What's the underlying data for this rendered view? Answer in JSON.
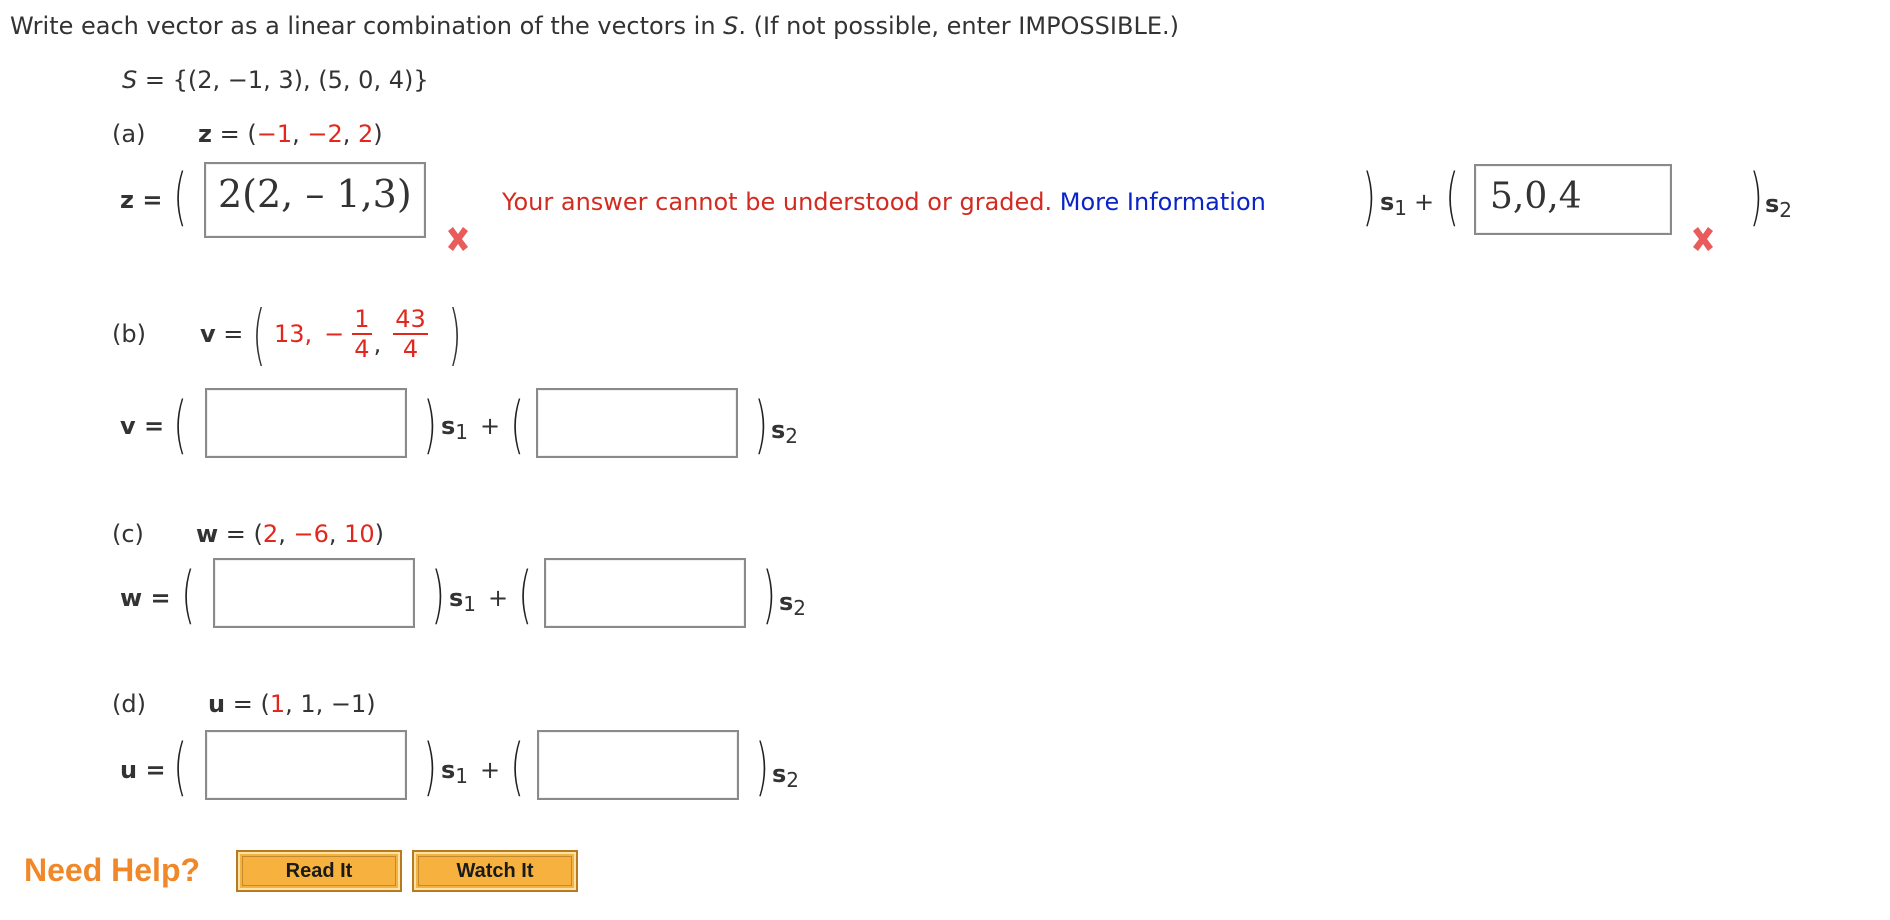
{
  "instructions": {
    "before_S": "Write each vector as a linear combination of the vectors in ",
    "S": "S",
    "after_S": ". (If not possible, enter IMPOSSIBLE.)"
  },
  "set_def": {
    "S": "S",
    "eq": " = {(2, −1, 3), (5, 0, 4)}"
  },
  "parts": {
    "a": {
      "label": "(a)",
      "vec": "z",
      "eq": " = (",
      "v1": "−1",
      "c1": ", ",
      "v2": "−2",
      "c2": ", ",
      "v3": "2",
      "close": ")",
      "row_label": "z =",
      "input1_value": "2(2, – 1,3)",
      "error_message": "Your answer cannot be understood or graded.",
      "more_info": "More Information",
      "input2_value": "5,0,4"
    },
    "b": {
      "label": "(b)",
      "vec": "v",
      "eq": " =",
      "v1": "13,",
      "minus": "−",
      "frac1_num": "1",
      "frac1_den": "4",
      "comma": ",",
      "frac2_num": "43",
      "frac2_den": "4",
      "row_label": "v ="
    },
    "c": {
      "label": "(c)",
      "vec": "w",
      "eq": " = (",
      "v1": "2",
      "c1": ", ",
      "v2": "−6",
      "c2": ", ",
      "v3": "10",
      "close": ")",
      "row_label": "w ="
    },
    "d": {
      "label": "(d)",
      "vec": "u",
      "eq": " = (",
      "v1": "1",
      "rest": ", 1, −1)",
      "row_label": "u ="
    }
  },
  "basis": {
    "s": "s",
    "sub1": "1",
    "sub2": "2",
    "plus": "+"
  },
  "help": {
    "label": "Need Help?",
    "read_it": "Read It",
    "watch_it": "Watch It"
  },
  "colors": {
    "value_red": "#e0281e",
    "error_red": "#d32b1f",
    "link_blue": "#0b24c8",
    "help_orange": "#f0882a",
    "button_fill": "#f6b13f"
  }
}
